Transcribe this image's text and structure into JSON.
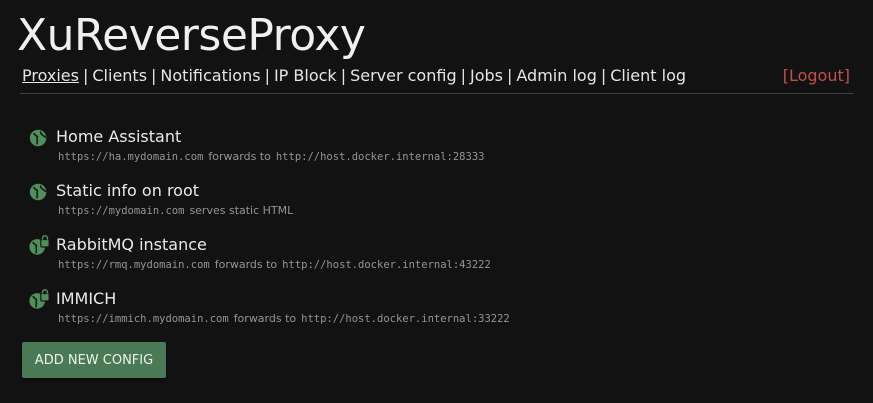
{
  "app": {
    "title": "XuReverseProxy"
  },
  "nav": {
    "items": [
      {
        "label": "Proxies",
        "active": true
      },
      {
        "label": "Clients"
      },
      {
        "label": "Notifications"
      },
      {
        "label": "IP Block"
      },
      {
        "label": "Server config"
      },
      {
        "label": "Jobs"
      },
      {
        "label": "Admin log"
      },
      {
        "label": "Client log"
      }
    ],
    "separator": "|",
    "logout_label": "[Logout]"
  },
  "colors": {
    "background": "#121212",
    "icon_green": "#4f8f5c",
    "logout_red": "#c0514a",
    "button_green": "#4a7a55"
  },
  "proxies": [
    {
      "name": "Home Assistant",
      "icon": "globe-icon",
      "source": "https://ha.mydomain.com",
      "verb": "forwards to",
      "target": "http://host.docker.internal:28333"
    },
    {
      "name": "Static info on root",
      "icon": "globe-icon",
      "source": "https://mydomain.com",
      "verb": "serves static HTML",
      "target": ""
    },
    {
      "name": "RabbitMQ instance",
      "icon": "globe-lock-icon",
      "source": "https://rmq.mydomain.com",
      "verb": "forwards to",
      "target": "http://host.docker.internal:43222"
    },
    {
      "name": "IMMICH",
      "icon": "globe-lock-icon",
      "source": "https://immich.mydomain.com",
      "verb": "forwards to",
      "target": "http://host.docker.internal:33222"
    }
  ],
  "actions": {
    "add_new_label": "ADD NEW CONFIG"
  }
}
